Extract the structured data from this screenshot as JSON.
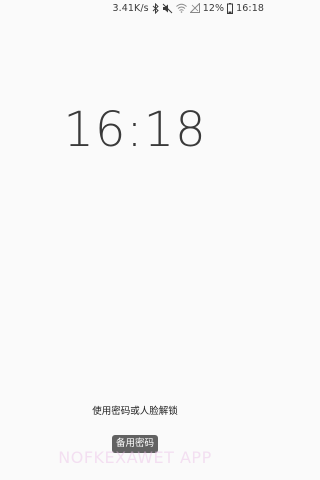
{
  "status_bar": {
    "network_speed": "3.41K/s",
    "battery_percent": "12%",
    "time": "16:18",
    "icons": [
      "bluetooth-icon",
      "mute-icon",
      "wifi-icon",
      "signal-icon",
      "battery-icon"
    ]
  },
  "lock_screen": {
    "clock": "16:18",
    "unlock_hint": "使用密码或人脸解锁",
    "backup_password_label": "备用密码"
  },
  "watermark": {
    "text": "NOFKEXAWET APP"
  },
  "colors": {
    "background": "#fafafa",
    "clock": "#3a3a3a",
    "button_bg": "#464646"
  }
}
